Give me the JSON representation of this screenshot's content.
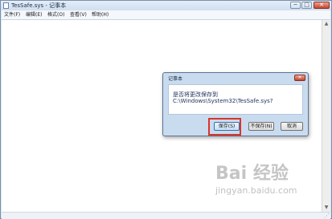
{
  "window": {
    "title": "TesSafe.sys - 记事本",
    "min_glyph": "─",
    "max_glyph": "□",
    "close_glyph": "✕"
  },
  "menubar": {
    "items": [
      "文件(F)",
      "编辑(E)",
      "格式(O)",
      "查看(V)",
      "帮助(H)"
    ]
  },
  "scrollbar": {
    "up_glyph": "▲",
    "down_glyph": "▼"
  },
  "dialog": {
    "title": "记事本",
    "close_glyph": "✕",
    "message_line1": "是否将更改保存到",
    "message_line2": "C:\\Windows\\System32\\TesSafe.sys?",
    "buttons": {
      "save": "保存(S)",
      "dont_save": "不保存(N)",
      "cancel": "取消"
    }
  },
  "watermark": {
    "logo": "Bai  经验",
    "url": "jingyan.baidu.com"
  },
  "colors": {
    "highlight": "#d9342b",
    "accent": "#3b6ea3"
  }
}
